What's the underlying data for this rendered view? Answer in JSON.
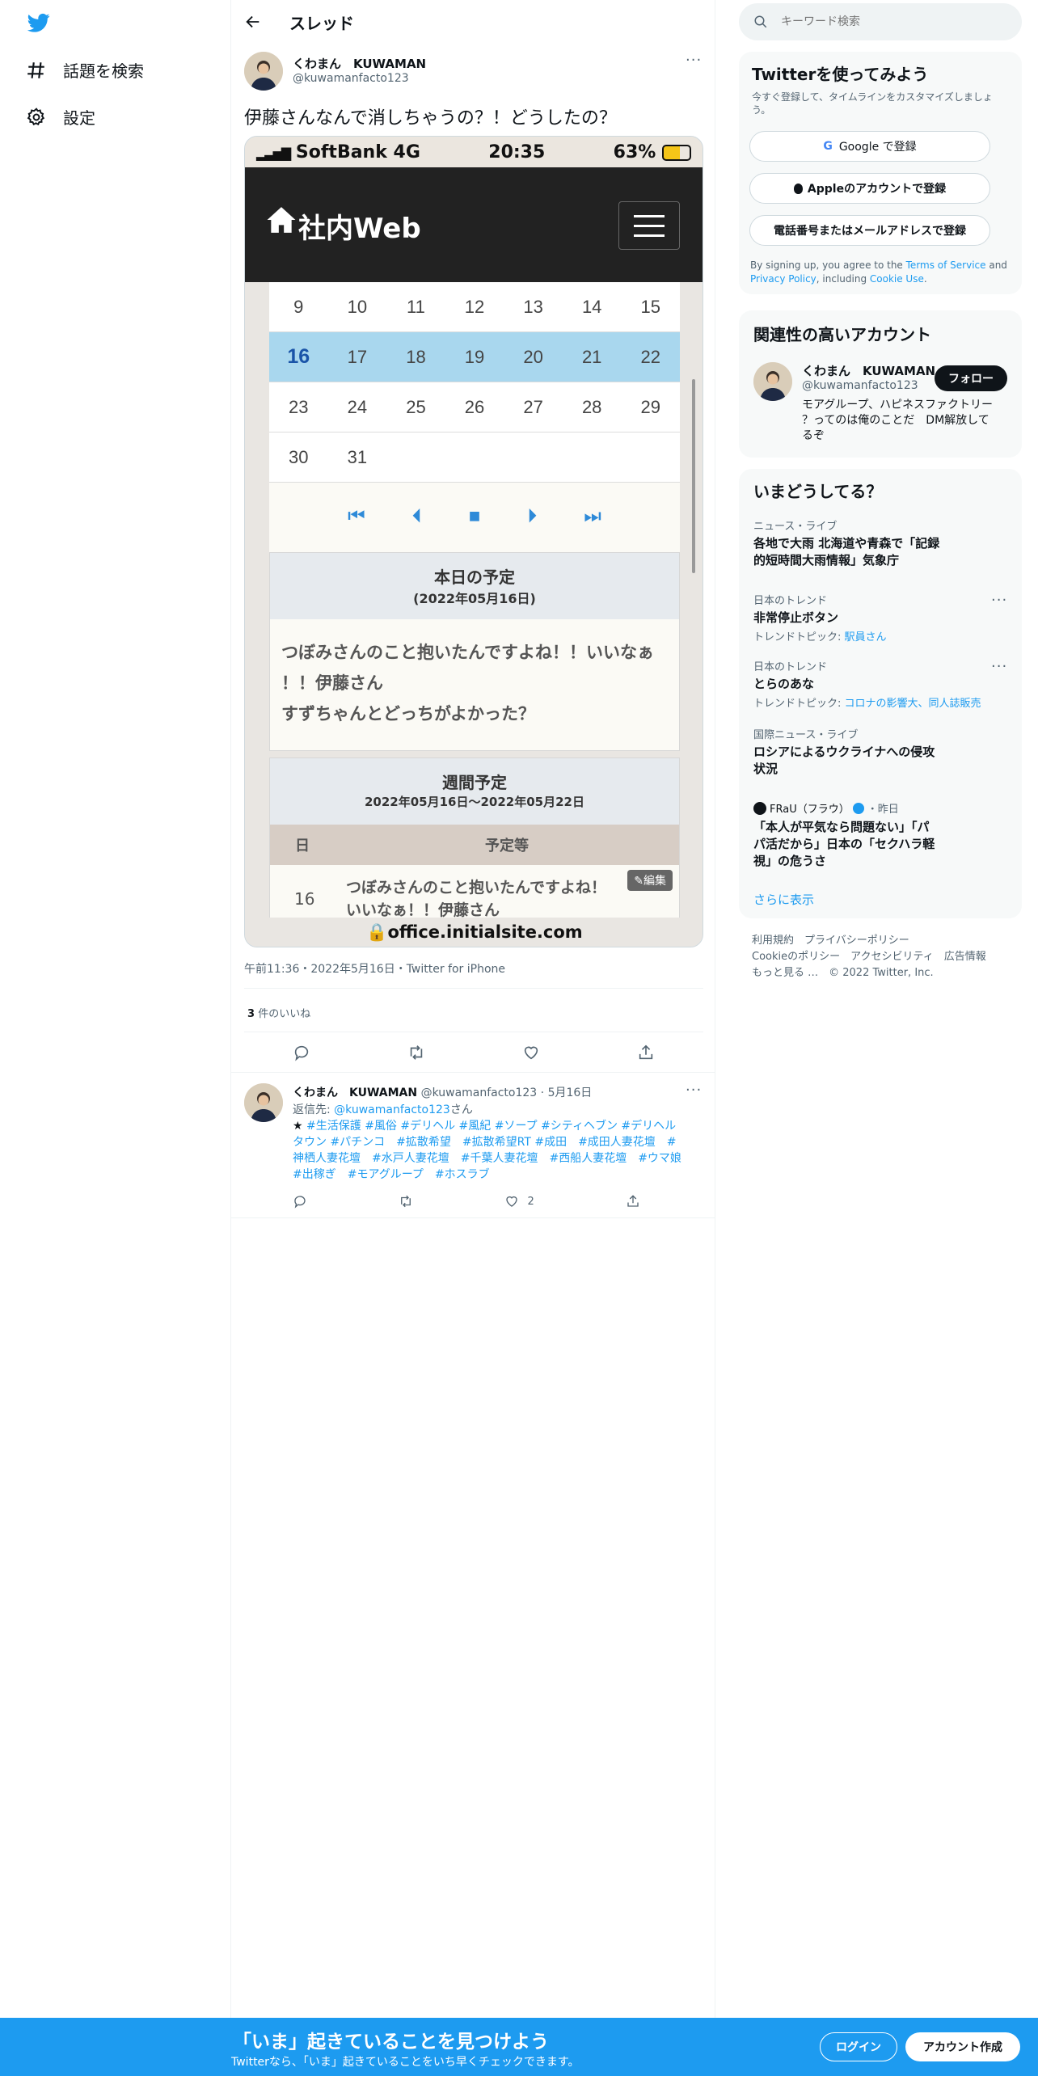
{
  "nav": {
    "items": [
      {
        "label": "話題を検索",
        "icon": "hash-icon"
      },
      {
        "label": "設定",
        "icon": "gear-icon"
      }
    ]
  },
  "header": {
    "title": "スレッド"
  },
  "tweet": {
    "name": "くわまん　KUWAMAN",
    "handle": "@kuwamanfacto123",
    "text": "伊藤さんなんで消しちゃうの？！どうしたの？",
    "meta": "午前11:36・2022年5月16日・Twitter for iPhone",
    "likes_count": "3",
    "likes_label": "件のいいね"
  },
  "shot": {
    "carrier": "SoftBank",
    "network": "4G",
    "time": "20:35",
    "battery": "63%",
    "site_title": "社内Web",
    "cal_rows": [
      [
        "9",
        "10",
        "11",
        "12",
        "13",
        "14",
        "15"
      ],
      [
        "16",
        "17",
        "18",
        "19",
        "20",
        "21",
        "22"
      ],
      [
        "23",
        "24",
        "25",
        "26",
        "27",
        "28",
        "29"
      ],
      [
        "30",
        "31",
        "",
        "",
        "",
        "",
        ""
      ]
    ],
    "today_title": "本日の予定",
    "today_date": "(2022年05月16日)",
    "today_text_1": "つぼみさんのこと抱いたんですよね！！いいなぁ",
    "today_text_2": "！！伊藤さん",
    "today_text_3": "すずちゃんとどっちがよかった？",
    "week_title": "週間予定",
    "week_range": "2022年05月16日〜2022年05月22日",
    "col_day": "日",
    "col_plan": "予定等",
    "row_day": "16",
    "row_text_1": "つぼみさんのこと抱いたんですよね！",
    "row_text_2": "いいなぁ！！伊藤さん",
    "edit": "編集",
    "url": "office.initialsite.com"
  },
  "reply": {
    "name": "くわまん　KUWAMAN",
    "handle": "@kuwamanfacto123",
    "date": "5月16日",
    "reply_to_label": "返信先: ",
    "reply_to_handle": "@kuwamanfacto123",
    "reply_to_suffix": "さん",
    "star": "★",
    "tags_line1": "#生活保護 #風俗 #デリヘル #風紀 #ソープ #シティヘブン #デリヘル",
    "tags_line2": "タウン #パチンコ　#拡散希望　#拡散希望RT #成田　#成田人妻花壇　#",
    "tags_line3": "神栖人妻花壇　#水戸人妻花壇　#千葉人妻花壇　#西船人妻花壇　#ウマ娘",
    "tags_line4": "#出稼ぎ　#モアグループ　#ホスラブ",
    "like_count": "2"
  },
  "search": {
    "placeholder": "キーワード検索"
  },
  "signup": {
    "title": "Twitterを使ってみよう",
    "sub": "今すぐ登録して、タイムラインをカスタマイズしましょう。",
    "google": "Google で登録",
    "apple": "Appleのアカウントで登録",
    "phone": "電話番号またはメールアドレスで登録",
    "terms_1": "By signing up, you agree to the ",
    "terms_link1": "Terms of Service",
    "terms_2": " and ",
    "terms_link2": "Privacy Policy",
    "terms_3": ", including ",
    "terms_link3": "Cookie Use",
    "terms_4": "."
  },
  "related": {
    "title": "関連性の高いアカウント",
    "name": "くわまん　KUWAMAN",
    "handle": "@kuwamanfacto123",
    "follow": "フォロー",
    "bio_1": "モアグループ、ハピネスファクトリー",
    "bio_2": "？ってのは俺のことだ　DM解放して",
    "bio_3": "るぞ"
  },
  "trends": {
    "title": "いまどうしてる？",
    "items": [
      {
        "cat": "ニュース・ライブ",
        "t1": "各地で大雨 北海道や青森で「記録",
        "t2": "的短時間大雨情報」気象庁"
      },
      {
        "cat": "日本のトレンド",
        "t1": "非常停止ボタン",
        "topic_label": "トレンドトピック: ",
        "topic": "駅員さん"
      },
      {
        "cat": "日本のトレンド",
        "t1": "とらのあな",
        "topic_label": "トレンドトピック: ",
        "topic": "コロナの影響大、同人誌販売"
      },
      {
        "cat": "国際ニュース・ライブ",
        "t1": "ロシアによるウクライナへの侵攻",
        "t2": "状況"
      },
      {
        "source": "FRaU（フラウ）",
        "when": "・昨日",
        "t1": "「本人が平気なら問題ない」「パ",
        "t2": "パ活だから」日本の「セクハラ軽",
        "t3": "視」の危うさ"
      }
    ],
    "more": "さらに表示"
  },
  "footer": {
    "l1": "利用規約　プライバシーポリシー",
    "l2": "Cookieのポリシー　アクセシビリティ　広告情報",
    "l3": "もっと見る …　© 2022 Twitter, Inc."
  },
  "bottom": {
    "title": "「いま」起きていることを見つけよう",
    "sub": "Twitterなら、「いま」起きていることをいち早くチェックできます。",
    "login": "ログイン",
    "signup": "アカウント作成"
  },
  "colors": {
    "accent": "#1d9bf0",
    "highlight": "#a9d7ee"
  }
}
